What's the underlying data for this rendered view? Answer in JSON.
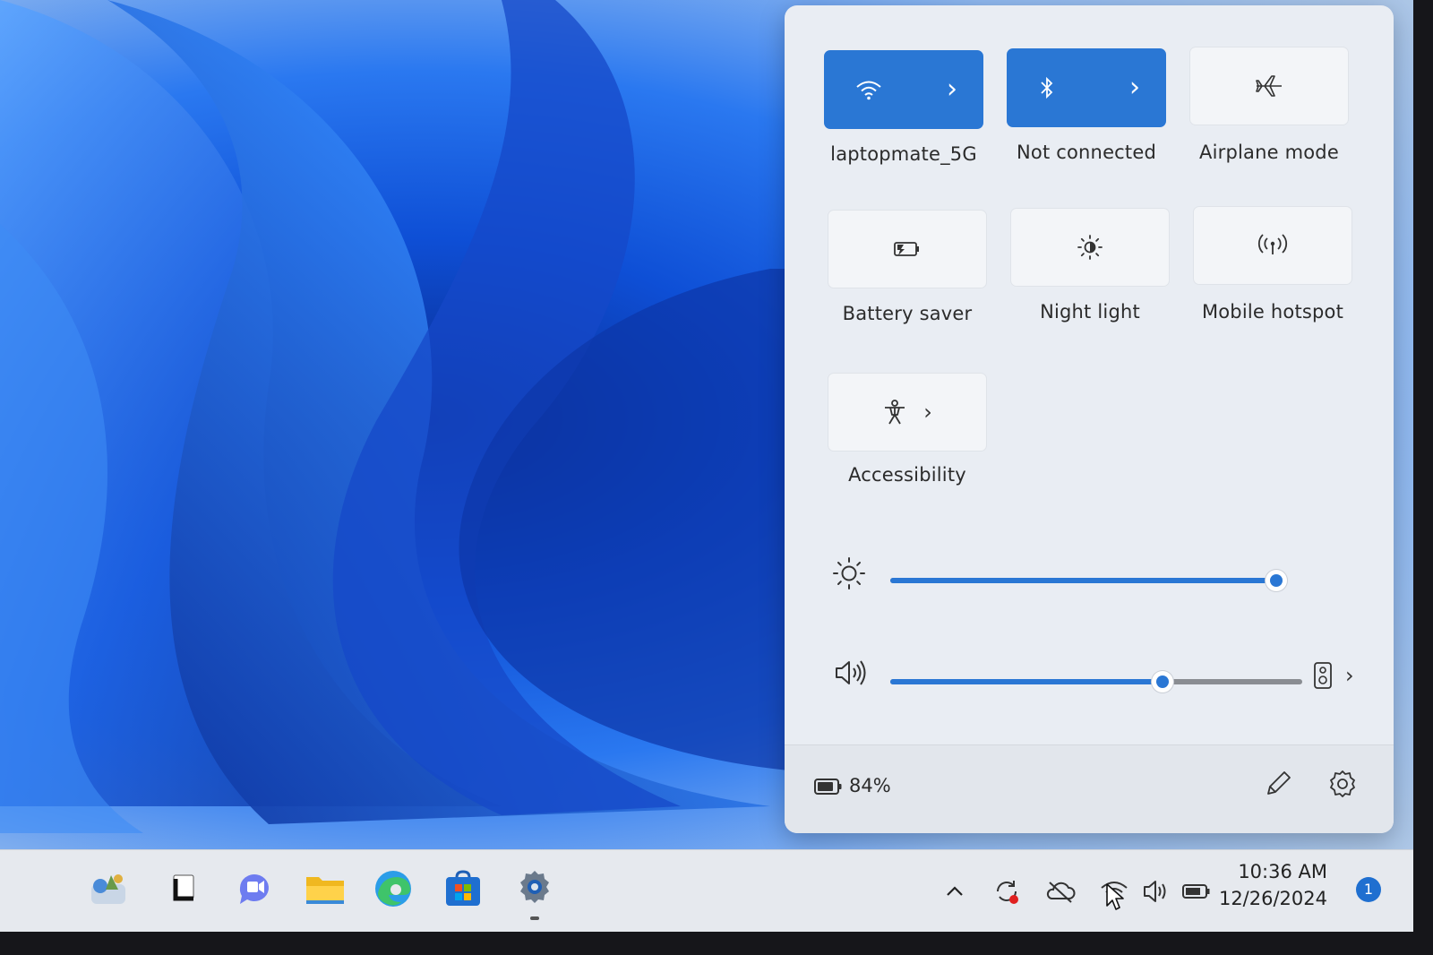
{
  "quick_settings": {
    "tiles": [
      {
        "label": "laptopmate_5G",
        "icon": "wifi-icon",
        "state": "on",
        "has_chevron": true
      },
      {
        "label": "Not connected",
        "icon": "bluetooth-icon",
        "state": "on",
        "has_chevron": true
      },
      {
        "label": "Airplane mode",
        "icon": "airplane-icon",
        "state": "off",
        "has_chevron": false
      },
      {
        "label": "Battery saver",
        "icon": "battery-saver-icon",
        "state": "off",
        "has_chevron": false
      },
      {
        "label": "Night light",
        "icon": "night-light-icon",
        "state": "off",
        "has_chevron": false
      },
      {
        "label": "Mobile hotspot",
        "icon": "hotspot-icon",
        "state": "off",
        "has_chevron": false
      },
      {
        "label": "Accessibility",
        "icon": "accessibility-icon",
        "state": "off",
        "has_chevron": true
      }
    ],
    "brightness": {
      "icon": "brightness-icon",
      "value": 0.98
    },
    "volume": {
      "icon": "speaker-icon",
      "value": 0.66,
      "output_icon": "audio-device-icon"
    },
    "footer": {
      "battery_text": "84%",
      "battery_icon": "battery-icon",
      "edit_icon": "pencil-icon",
      "settings_icon": "gear-icon"
    }
  },
  "taskbar": {
    "apps": [
      "widgets-icon",
      "task-view-icon",
      "teams-chat-icon",
      "file-explorer-icon",
      "edge-icon",
      "store-icon",
      "settings-icon"
    ],
    "tray": [
      "chevron-up-icon",
      "sync-icon",
      "onedrive-icon",
      "wifi-icon",
      "speaker-icon",
      "battery-icon"
    ],
    "time": "10:36 AM",
    "date": "12/26/2024",
    "notification_count": "1"
  },
  "colors": {
    "accent": "#2a77d4",
    "panel_bg": "#e9edf3",
    "taskbar_bg": "#e6e9ee"
  }
}
